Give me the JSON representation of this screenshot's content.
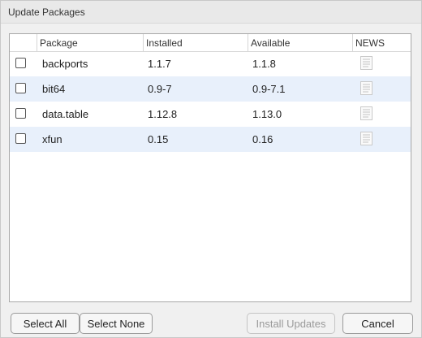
{
  "window": {
    "title": "Update Packages"
  },
  "table": {
    "columns": [
      "Package",
      "Installed",
      "Available",
      "NEWS"
    ],
    "rows": [
      {
        "package": "backports",
        "installed": "1.1.7",
        "available": "1.1.8",
        "checked": false,
        "news_icon": "document-icon"
      },
      {
        "package": "bit64",
        "installed": "0.9-7",
        "available": "0.9-7.1",
        "checked": false,
        "news_icon": "document-icon"
      },
      {
        "package": "data.table",
        "installed": "1.12.8",
        "available": "1.13.0",
        "checked": false,
        "news_icon": "document-icon"
      },
      {
        "package": "xfun",
        "installed": "0.15",
        "available": "0.16",
        "checked": false,
        "news_icon": "document-icon"
      }
    ]
  },
  "buttons": {
    "select_all": "Select All",
    "select_none": "Select None",
    "install_updates": "Install Updates",
    "cancel": "Cancel"
  },
  "colors": {
    "row_alt": "#e8f0fb",
    "dialog_bg": "#f0f0f0"
  }
}
